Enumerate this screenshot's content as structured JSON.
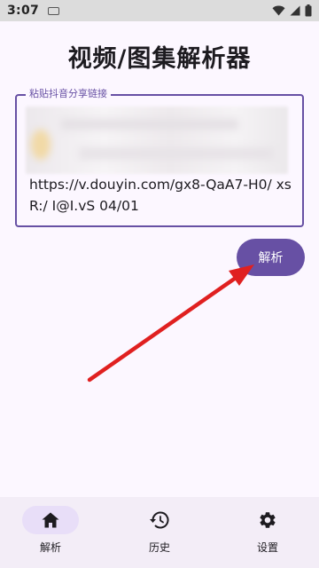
{
  "status_bar": {
    "time": "3:07",
    "icons": [
      "keyboard-icon",
      "wifi-icon",
      "signal-icon",
      "battery-icon"
    ]
  },
  "page": {
    "title": "视频/图集解析器"
  },
  "share_field": {
    "label": "粘贴抖音分享链接",
    "value": "https://v.douyin.com/gx8-QaA7-H0/ xsR:/ I@I.vS 04/01"
  },
  "parse_button": {
    "label": "解析"
  },
  "bottom_nav": {
    "items": [
      {
        "label": "解析",
        "icon": "home-icon",
        "active": true
      },
      {
        "label": "历史",
        "icon": "history-icon",
        "active": false
      },
      {
        "label": "设置",
        "icon": "gear-icon",
        "active": false
      }
    ]
  },
  "colors": {
    "primary": "#6750a4",
    "background": "#fcf7ff",
    "nav_background": "#f3edf7",
    "nav_indicator": "#e8def8",
    "annotation_arrow": "#e02020"
  }
}
